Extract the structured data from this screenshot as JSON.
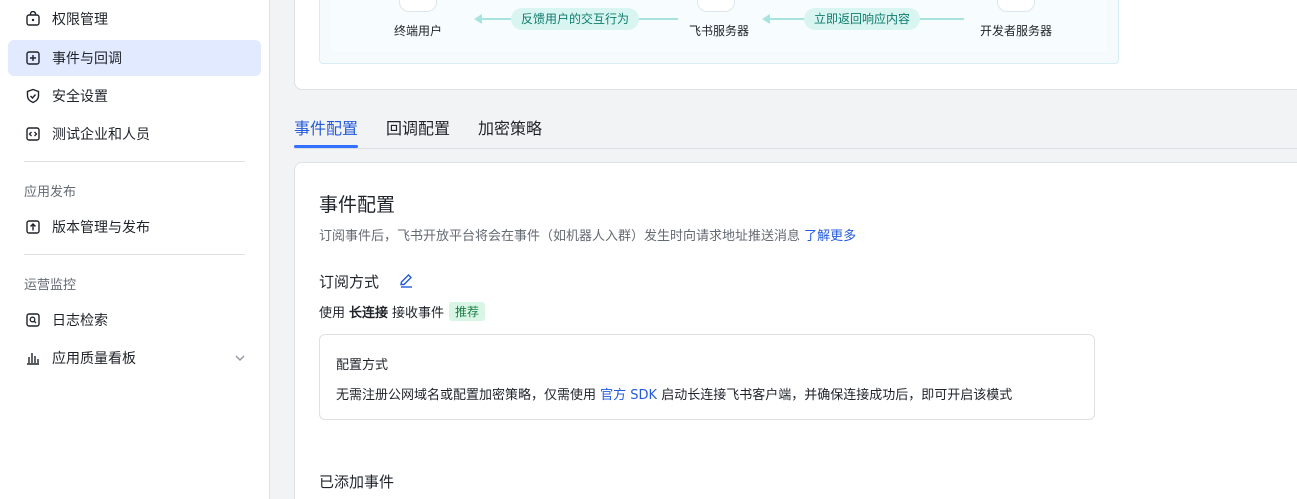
{
  "sidebar": {
    "items": [
      {
        "label": "权限管理",
        "icon": "lock-icon"
      },
      {
        "label": "事件与回调",
        "icon": "event-plus-icon",
        "active": true
      },
      {
        "label": "安全设置",
        "icon": "shield-icon"
      },
      {
        "label": "测试企业和人员",
        "icon": "code-icon"
      }
    ],
    "section_publish": "应用发布",
    "publish_items": [
      {
        "label": "版本管理与发布",
        "icon": "upload-icon"
      }
    ],
    "section_ops": "运营监控",
    "ops_items": [
      {
        "label": "日志检索",
        "icon": "log-search-icon"
      },
      {
        "label": "应用质量看板",
        "icon": "bar-chart-icon"
      }
    ]
  },
  "flow": {
    "node_end_user": "终端用户",
    "node_feishu_server": "飞书服务器",
    "node_dev_server": "开发者服务器",
    "pill_feedback": "反馈用户的交互行为",
    "pill_return": "立即返回响应内容"
  },
  "tabs": [
    {
      "label": "事件配置",
      "active": true
    },
    {
      "label": "回调配置"
    },
    {
      "label": "加密策略"
    }
  ],
  "event_config": {
    "title": "事件配置",
    "desc": "订阅事件后，飞书开放平台将会在事件（如机器人入群）发生时向请求地址推送消息",
    "learn_more": "了解更多",
    "subscribe_title": "订阅方式",
    "use_prefix": "使用",
    "use_bold": "长连接",
    "use_suffix": "接收事件",
    "recommend_badge": "推荐",
    "config_title": "配置方式",
    "config_text_1": "无需注册公网域名或配置加密策略，仅需使用",
    "config_link": "官方 SDK",
    "config_text_2": "启动长连接飞书客户端，并确保连接成功后，即可开启该模式",
    "added_title": "已添加事件"
  },
  "colors": {
    "accent": "#3370ff",
    "link": "#245bdb",
    "active_bg": "#e1eaff",
    "flow_pill": "#d9f5f1"
  }
}
